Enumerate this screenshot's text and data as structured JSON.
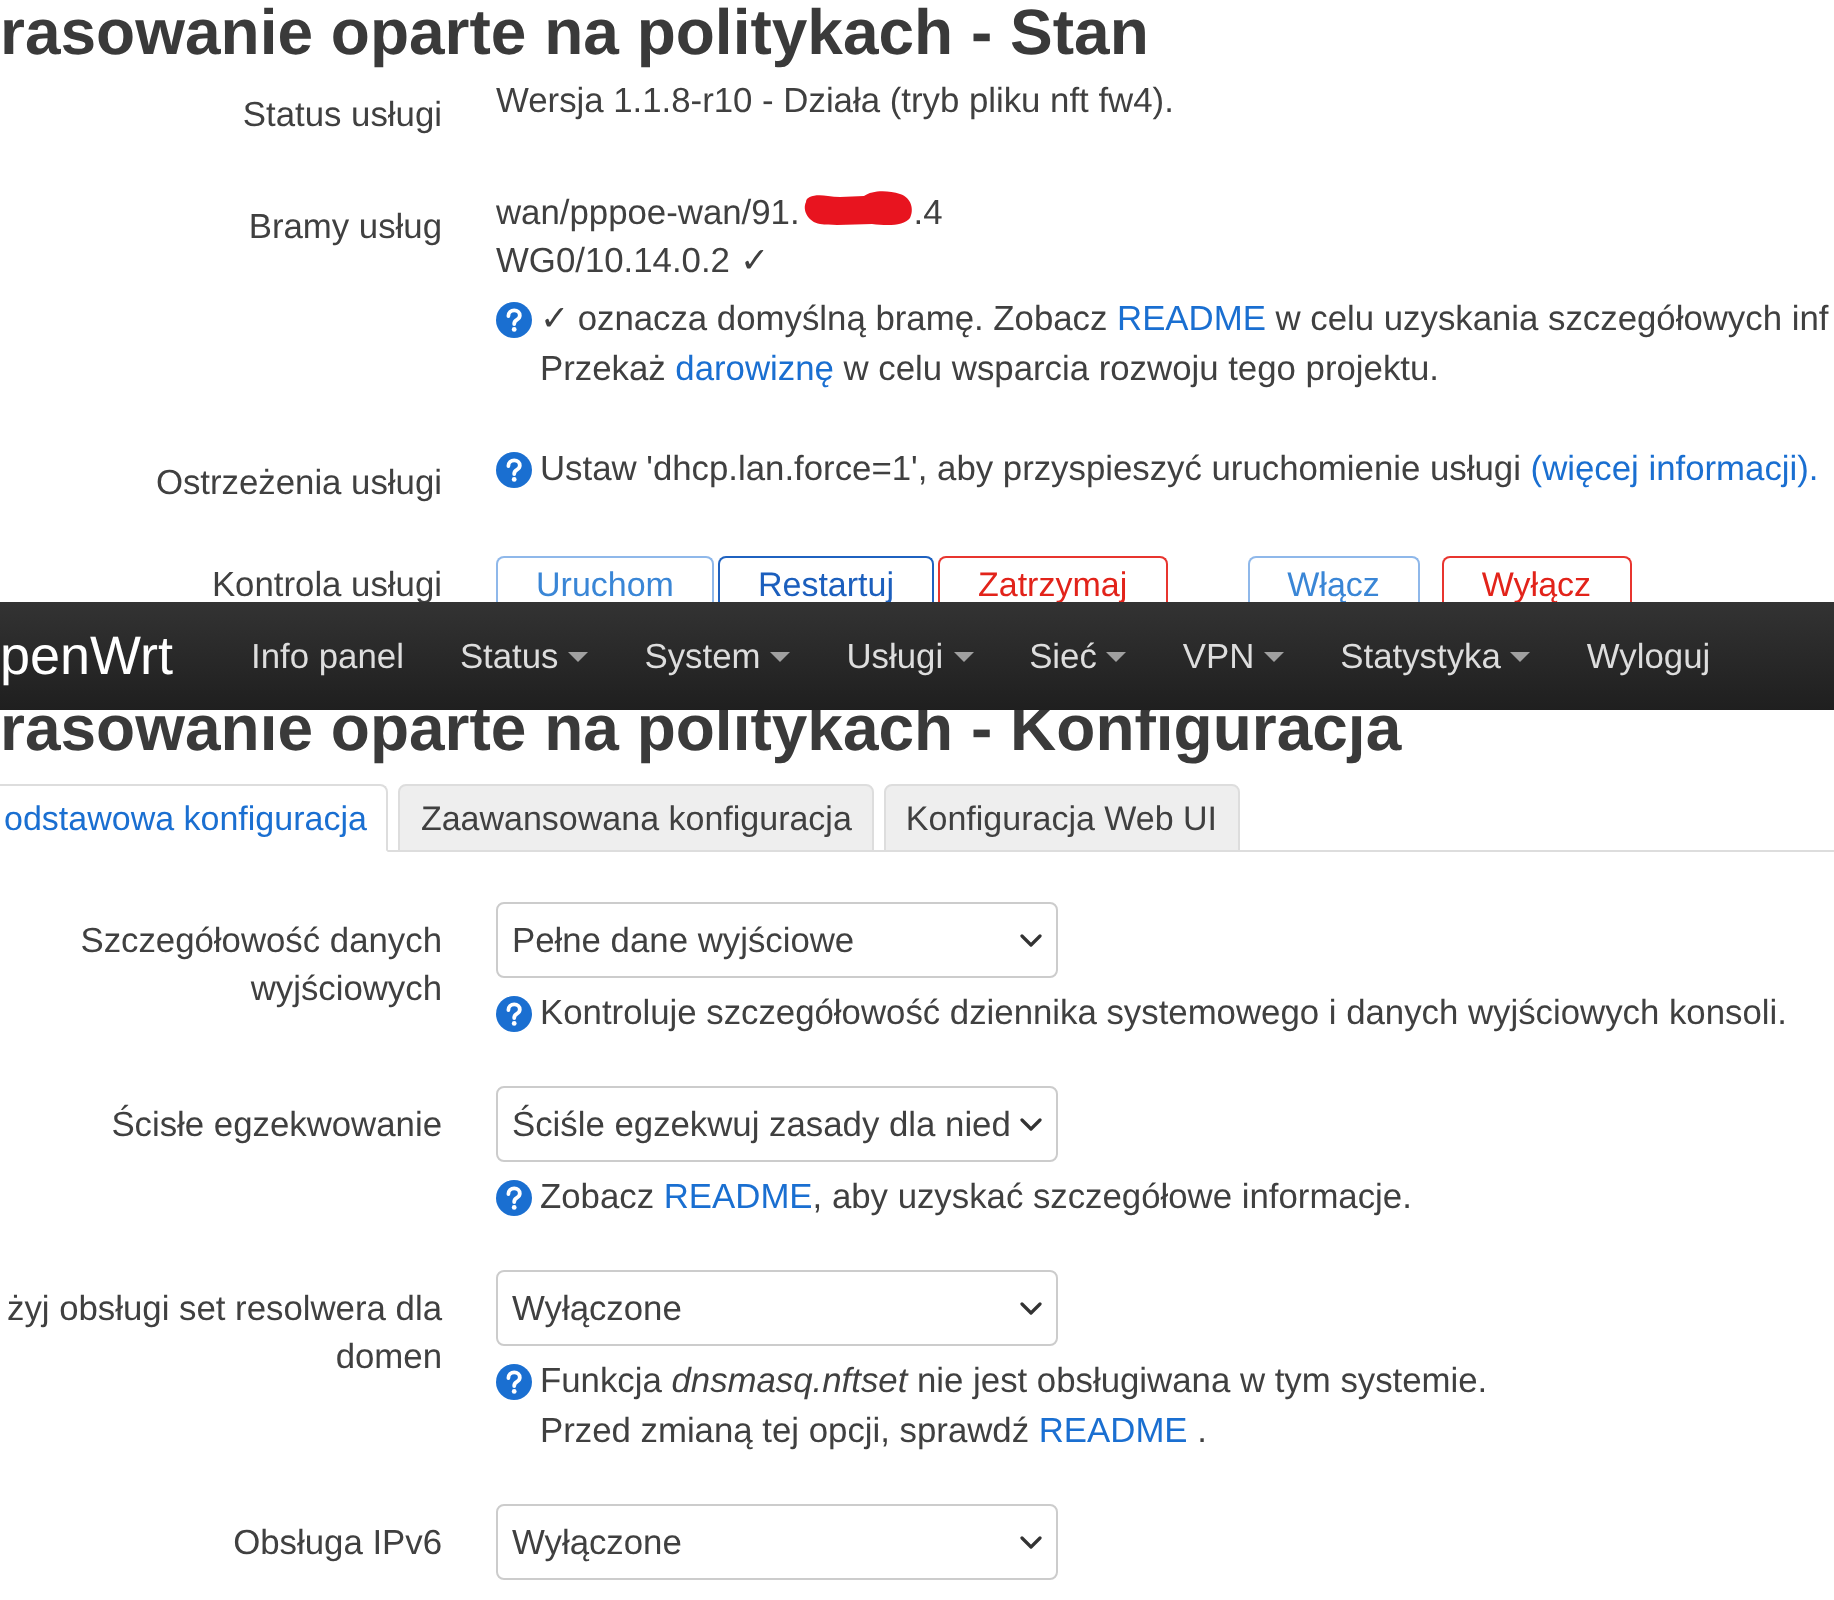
{
  "status": {
    "title": "rasowanie oparte na politykach - Stan",
    "rows": [
      {
        "label": "Status usługi",
        "kind": "text",
        "lines": [
          "Wersja 1.1.8-r10 - Działa (tryb pliku nft fw4)."
        ]
      },
      {
        "label": "Bramy usług",
        "kind": "gateways",
        "gateways": [
          {
            "text": "wan/pppoe-wan/91.",
            "redacted": true,
            "text_end": ".4"
          },
          {
            "text": "WG0/10.14.0.2 ✓",
            "redacted": false
          }
        ],
        "help": [
          [
            {
              "kind": "text",
              "text": "✓ oznacza domyślną bramę. Zobacz "
            },
            {
              "kind": "link",
              "text": "README"
            },
            {
              "kind": "text",
              "text": " w celu uzyskania szczegółowych inf"
            }
          ],
          [
            {
              "kind": "text",
              "text": "Przekaż "
            },
            {
              "kind": "link",
              "text": "darowiznę"
            },
            {
              "kind": "text",
              "text": " w celu wsparcia rozwoju tego projektu."
            }
          ]
        ]
      },
      {
        "label": "Ostrzeżenia usługi",
        "kind": "help",
        "help": [
          [
            {
              "kind": "text",
              "text": "Ustaw 'dhcp.lan.force=1', aby przyspieszyć uruchomienie usługi "
            },
            {
              "kind": "link",
              "text": "(więcej informacji)."
            }
          ]
        ]
      },
      {
        "label": "Kontrola usługi",
        "kind": "buttons",
        "button_groups": [
          [
            {
              "label": "Uruchom",
              "kind": "apply",
              "focused": false
            },
            {
              "label": "Restartuj",
              "kind": "apply",
              "focused": true
            },
            {
              "label": "Zatrzymaj",
              "kind": "negative",
              "focused": false
            }
          ],
          [
            {
              "label": "Włącz",
              "kind": "apply",
              "focused": false
            },
            {
              "label": "Wyłącz",
              "kind": "negative",
              "focused": false
            }
          ]
        ]
      }
    ]
  },
  "navbar": {
    "brand": "penWrt",
    "items": [
      {
        "label": "Info panel",
        "dropdown": false
      },
      {
        "label": "Status",
        "dropdown": true
      },
      {
        "label": "System",
        "dropdown": true
      },
      {
        "label": "Usługi",
        "dropdown": true
      },
      {
        "label": "Sieć",
        "dropdown": true
      },
      {
        "label": "VPN",
        "dropdown": true
      },
      {
        "label": "Statystyka",
        "dropdown": true
      },
      {
        "label": "Wyloguj",
        "dropdown": false
      }
    ]
  },
  "config": {
    "title": "rasowanie oparte na politykach - Konfiguracja",
    "tabs": [
      {
        "label": "odstawowa konfiguracja",
        "selected": true
      },
      {
        "label": "Zaawansowana konfiguracja",
        "selected": false
      },
      {
        "label": "Konfiguracja Web UI",
        "selected": false
      }
    ],
    "fields": [
      {
        "label": "Szczegółowość danych wyjściowych",
        "value": "Pełne dane wyjściowe",
        "help": [
          [
            {
              "kind": "text",
              "text": "Kontroluje szczegółowość dziennika systemowego i danych wyjściowych konsoli."
            }
          ]
        ]
      },
      {
        "label": "Ścisłe egzekwowanie",
        "value": "Ściśle egzekwuj zasady dla nied",
        "help": [
          [
            {
              "kind": "text",
              "text": "Zobacz "
            },
            {
              "kind": "link",
              "text": "README"
            },
            {
              "kind": "text",
              "text": ", aby uzyskać szczegółowe informacje."
            }
          ]
        ]
      },
      {
        "label": "żyj obsługi set resolwera dla domen",
        "value": "Wyłączone",
        "help": [
          [
            {
              "kind": "text",
              "text": "Funkcja *dnsmasq.nftset* nie jest obsługiwana w tym systemie."
            }
          ],
          [
            {
              "kind": "text",
              "text": "Przed zmianą tej opcji, sprawdź "
            },
            {
              "kind": "link",
              "text": "README"
            },
            {
              "kind": "text",
              "text": " ."
            }
          ]
        ]
      },
      {
        "label": "Obsługa IPv6",
        "value": "Wyłączone"
      }
    ]
  }
}
